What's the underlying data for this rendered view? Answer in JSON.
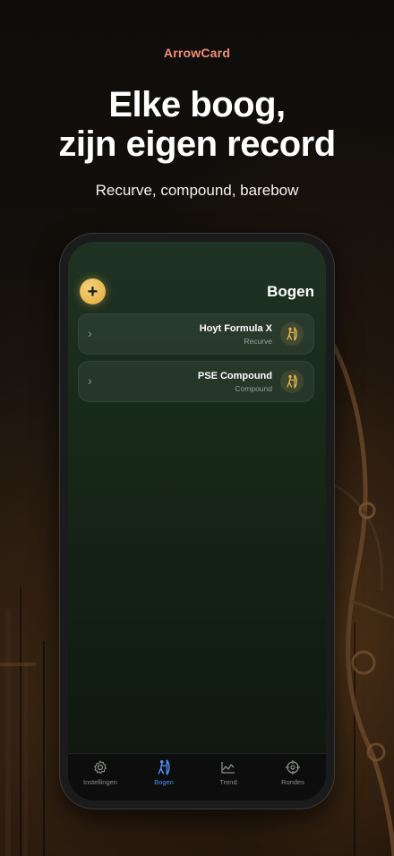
{
  "marketing": {
    "brand": "ArrowCard",
    "headline_line1": "Elke boog,",
    "headline_line2": "zijn eigen record",
    "subline": "Recurve, compound, barebow"
  },
  "screen": {
    "title": "Bogen",
    "add_button_icon": "plus-icon",
    "bows": [
      {
        "name": "Hoyt Formula X",
        "type": "Recurve",
        "icon": "archer-icon"
      },
      {
        "name": "PSE Compound",
        "type": "Compound",
        "icon": "archer-icon"
      }
    ]
  },
  "tabbar": {
    "tabs": [
      {
        "label": "Instellingen",
        "icon": "gear-icon",
        "active": false
      },
      {
        "label": "Bogen",
        "icon": "archer-icon",
        "active": true
      },
      {
        "label": "Trend",
        "icon": "chart-icon",
        "active": false
      },
      {
        "label": "Rondes",
        "icon": "crosshair-icon",
        "active": false
      }
    ]
  },
  "colors": {
    "brand": "#f08c7a",
    "accent_gold": "#e6b64d",
    "active_tab": "#4f8df5",
    "screen_bg": "#172818"
  }
}
